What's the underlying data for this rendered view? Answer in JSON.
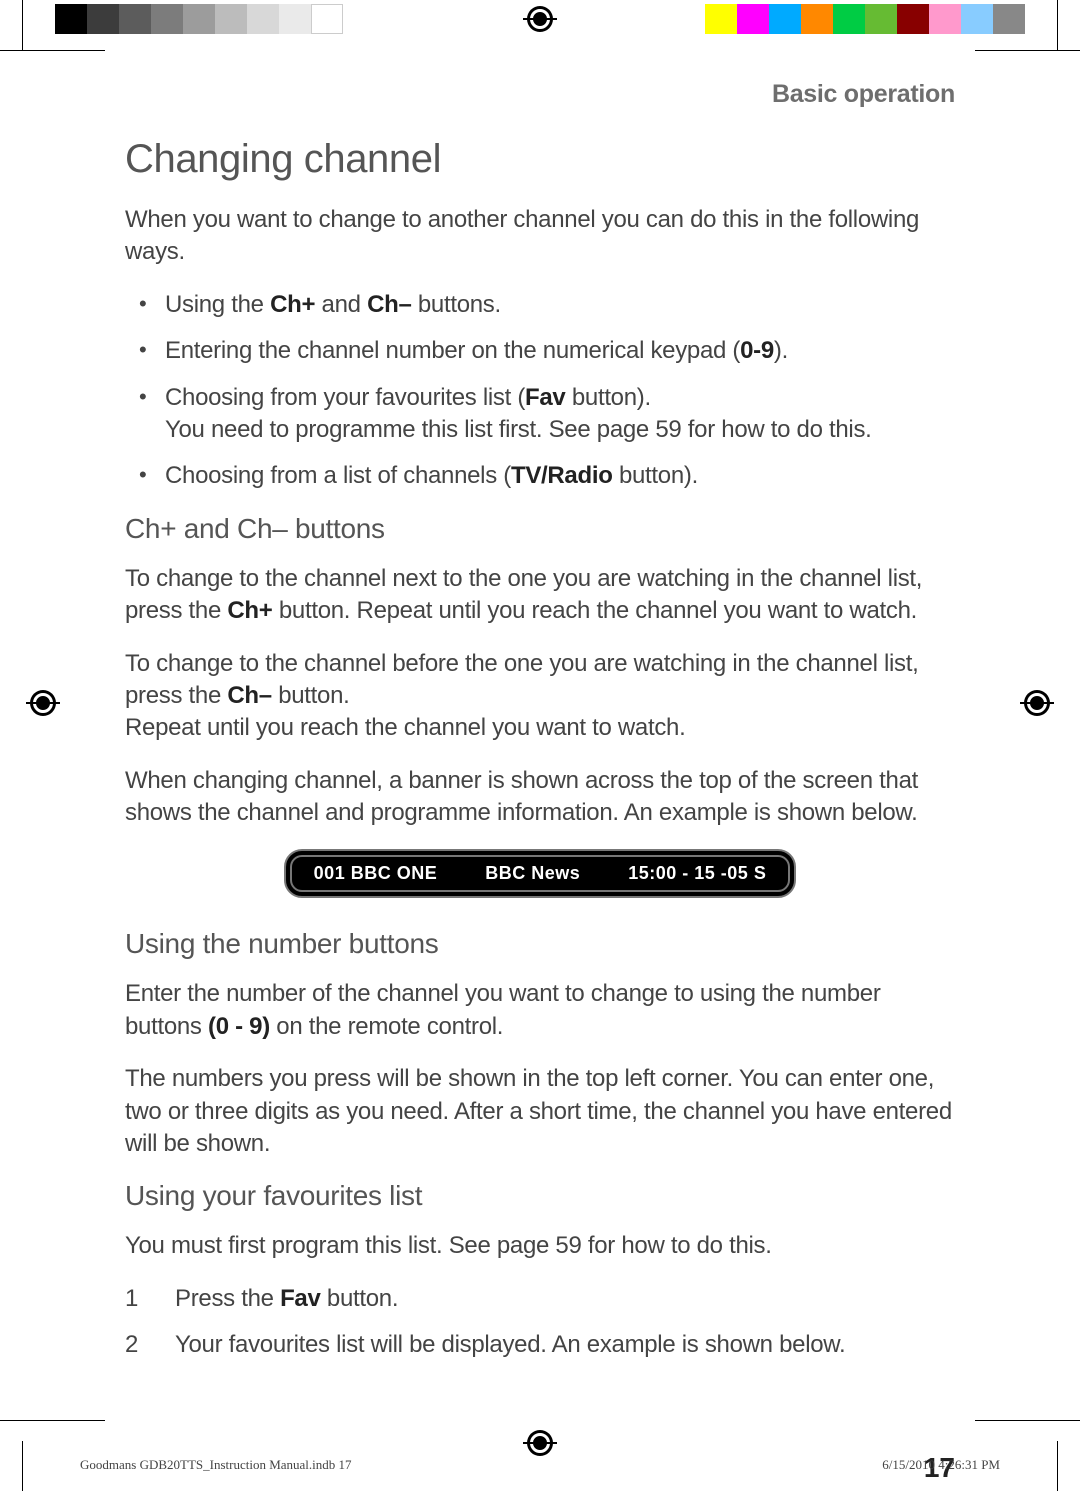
{
  "section_label": "Basic operation",
  "title": "Changing channel",
  "intro": "When you want to change to another channel you can do this in the following ways.",
  "bullets": {
    "b1a": "Using the ",
    "b1b": "Ch+",
    "b1c": " and ",
    "b1d": "Ch–",
    "b1e": " buttons.",
    "b2a": "Entering the channel number on the numerical keypad (",
    "b2b": "0-9",
    "b2c": ").",
    "b3a": "Choosing from your favourites list (",
    "b3b": "Fav",
    "b3c": " button).",
    "b3d": "You need to programme this list first. See page 59 for how to do this.",
    "b4a": "Choosing from a list of channels (",
    "b4b": "TV/Radio",
    "b4c": " button)."
  },
  "h2_chbuttons": "Ch+ and Ch– buttons",
  "p_ch1a": "To change to the channel next to the one you are watching in the channel list, press the ",
  "p_ch1b": "Ch+",
  "p_ch1c": " button. Repeat until you reach the channel you want to watch.",
  "p_ch2a": "To change to the channel before the one you are watching in the channel list, press the ",
  "p_ch2b": "Ch–",
  "p_ch2c": " button.",
  "p_ch2d": "Repeat until you reach the channel you want to watch.",
  "p_banner": "When changing channel, a banner is shown across the top of the screen that shows the channel and programme information. An example is shown below.",
  "banner": {
    "left": "001  BBC ONE",
    "mid": "BBC News",
    "right": "15:00 - 15 -05  S"
  },
  "h2_number": "Using the number buttons",
  "p_num1a": "Enter the number of the channel you want to change to using the number buttons ",
  "p_num1b": "(0 - 9)",
  "p_num1c": " on the remote control.",
  "p_num2": "The numbers you press will be shown in the top left corner. You can enter one, two or three digits as you need. After a short time, the channel you have entered will be shown.",
  "h2_fav": "Using your favourites list",
  "p_fav1": "You must first program this list. See page 59 for how to do this.",
  "fav_steps": {
    "n1": "1",
    "s1a": "Press the ",
    "s1b": "Fav",
    "s1c": " button.",
    "n2": "2",
    "s2": "Your favourites list will be displayed. An example is shown below."
  },
  "page_number": "17",
  "footer": {
    "left": "Goodmans GDB20TTS_Instruction Manual.indb   17",
    "right": "6/15/2010   4:26:31 PM"
  }
}
